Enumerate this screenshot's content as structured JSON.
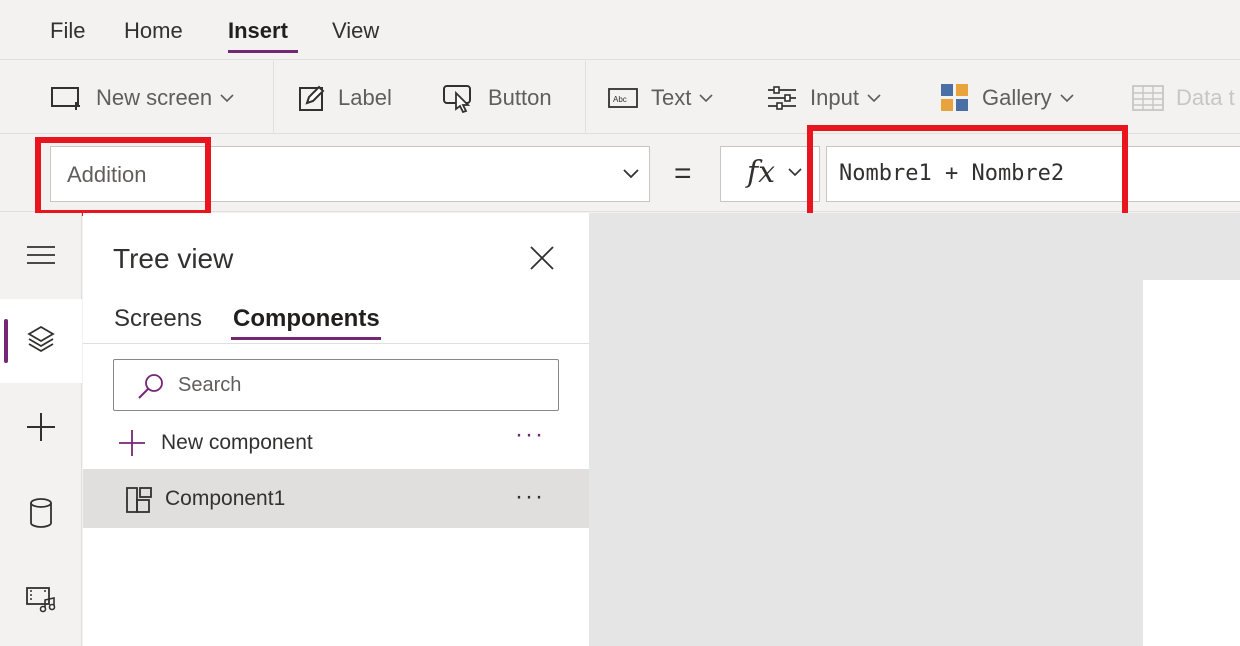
{
  "menu": {
    "items": [
      {
        "label": "File"
      },
      {
        "label": "Home"
      },
      {
        "label": "Insert",
        "active": true
      },
      {
        "label": "View"
      }
    ]
  },
  "ribbon": {
    "new_screen": "New screen",
    "label": "Label",
    "button": "Button",
    "text": "Text",
    "input": "Input",
    "gallery": "Gallery",
    "data_table": "Data t"
  },
  "formula_bar": {
    "property": "Addition",
    "equals": "=",
    "fx": "fx",
    "formula": "Nombre1 + Nombre2"
  },
  "tree_view": {
    "title": "Tree view",
    "tabs": [
      {
        "label": "Screens"
      },
      {
        "label": "Components",
        "active": true
      }
    ],
    "search_placeholder": "Search",
    "new_component": "New component",
    "more": "···",
    "items": [
      {
        "label": "Component1",
        "selected": true
      }
    ]
  },
  "colors": {
    "accent": "#742774",
    "highlight": "#e8141e"
  }
}
